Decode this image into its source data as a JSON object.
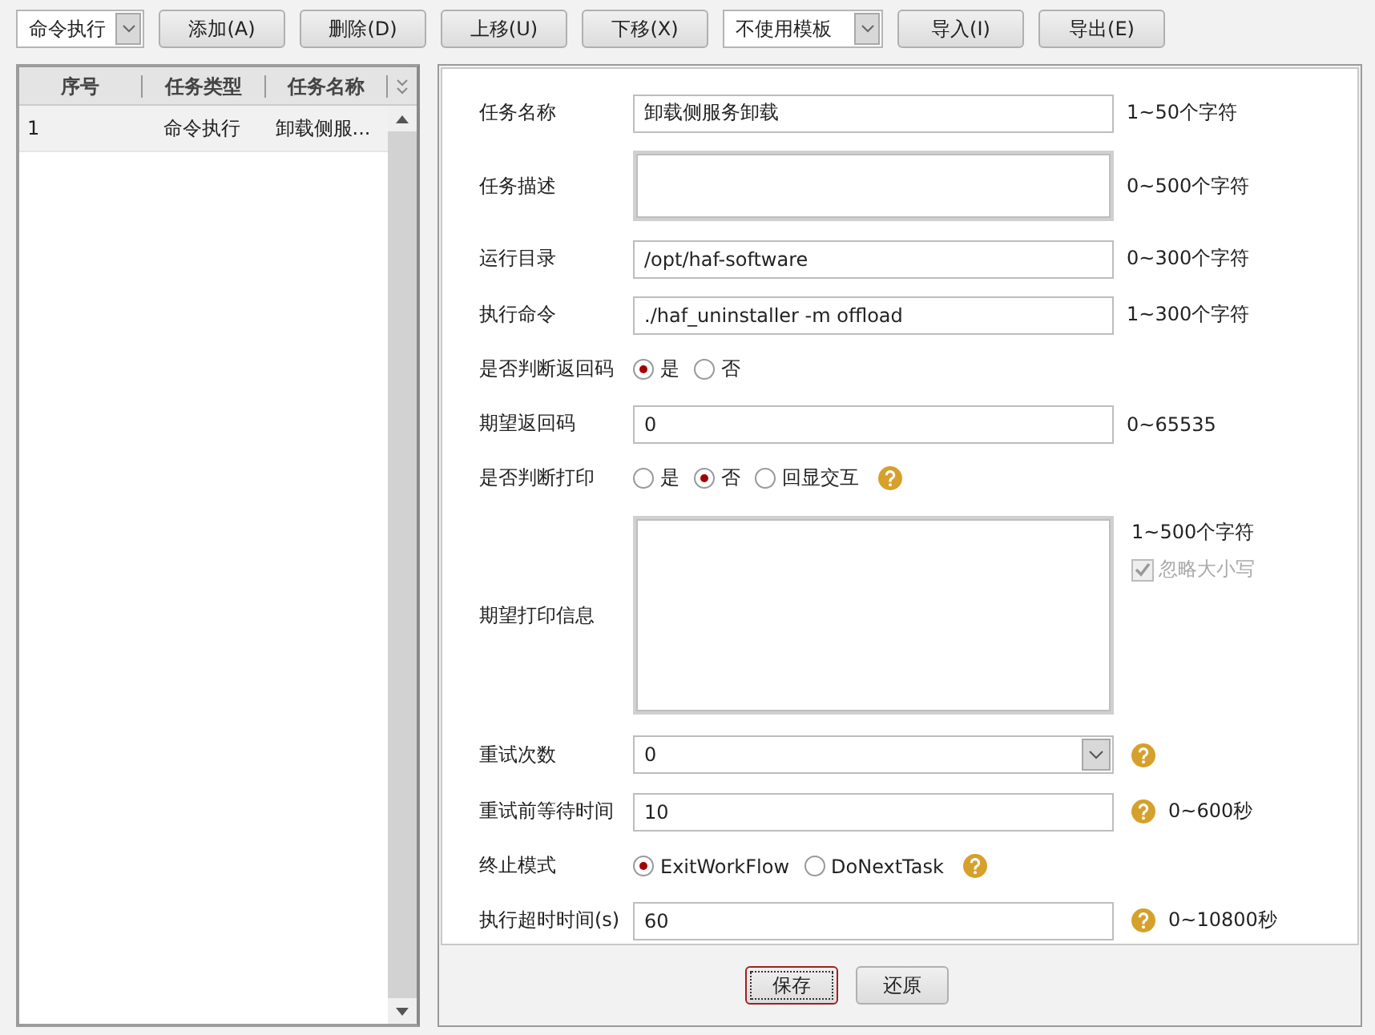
{
  "toolbar": {
    "type_select": {
      "value": "命令执行"
    },
    "buttons": [
      "添加(A)",
      "删除(D)",
      "上移(U)",
      "下移(X)"
    ],
    "template_select": {
      "value": "不使用模板"
    },
    "buttons_2": [
      "导入(I)",
      "导出(E)"
    ]
  },
  "task_table": {
    "columns": [
      "序号",
      "任务类型",
      "任务名称"
    ],
    "rows": [
      {
        "cells": [
          "1",
          "命令执行",
          "卸载侧服..."
        ],
        "selected": true
      }
    ]
  },
  "form": {
    "fields": [
      {
        "kind": "text",
        "label": "任务名称",
        "value": "卸载侧服务卸载",
        "hint": "1~50个字符"
      },
      {
        "kind": "textarea",
        "label": "任务描述",
        "hint": "0~500个字符"
      },
      {
        "kind": "text",
        "label": "运行目录",
        "value": "/opt/haf-software",
        "hint": "0~300个字符"
      },
      {
        "kind": "text",
        "label": "执行命令",
        "value": "./haf_uninstaller -m offload",
        "hint": "1~300个字符"
      },
      {
        "kind": "radio",
        "label": "是否判断返回码",
        "options": [
          {
            "label": "是",
            "selected": true
          },
          {
            "label": "否",
            "selected": false
          }
        ]
      },
      {
        "kind": "text",
        "label": "期望返回码",
        "value": "0",
        "hint": "0~65535"
      },
      {
        "kind": "radio",
        "label": "是否判断打印",
        "options": [
          {
            "label": "是",
            "selected": false
          },
          {
            "label": "否",
            "selected": true
          },
          {
            "label": "回显交互",
            "selected": false
          }
        ],
        "help": true
      },
      {
        "kind": "bigtextarea",
        "label": "期望打印信息",
        "hint": "1~500个字符",
        "checkbox": {
          "label": "忽略大小写",
          "checked": true,
          "disabled": true
        }
      },
      {
        "kind": "select",
        "label": "重试次数",
        "value": "0",
        "help": true
      },
      {
        "kind": "text",
        "label": "重试前等待时间",
        "value": "10",
        "hint": "0~600秒",
        "help": true
      },
      {
        "kind": "radio",
        "label": "终止模式",
        "options": [
          {
            "label": "ExitWorkFlow",
            "selected": true
          },
          {
            "label": "DoNextTask",
            "selected": false
          }
        ],
        "help": true
      },
      {
        "kind": "text",
        "label": "执行超时时间(s)",
        "value": "60",
        "hint": "0~10800秒",
        "help": true
      }
    ]
  },
  "footer_buttons": [
    {
      "label": "保存",
      "focused": true
    },
    {
      "label": "还原",
      "focused": false
    }
  ]
}
